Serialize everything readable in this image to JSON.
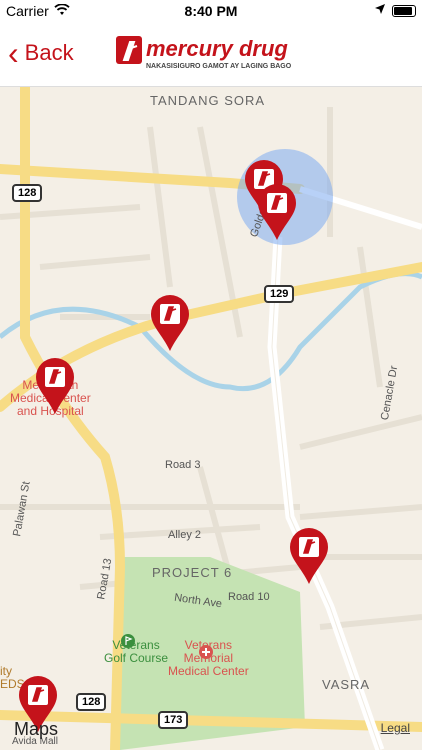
{
  "status": {
    "carrier": "Carrier",
    "time": "8:40 PM"
  },
  "nav": {
    "back_label": "Back",
    "logo_name": "mercury drug",
    "logo_tagline": "NAKASISIGURO GAMOT AY LAGING BAGO",
    "brand_color": "#c4131b"
  },
  "map": {
    "areas": {
      "tandang_sora": "TANDANG SORA",
      "project6": "PROJECT 6",
      "vasra": "VASRA"
    },
    "roads": {
      "road3": "Road 3",
      "alley2": "Alley 2",
      "road10": "Road 10",
      "north_ave": "North Ave",
      "cenacle": "Cenacle Dr",
      "road13": "Road 13",
      "palawan": "Palawan St",
      "golden": "Golde"
    },
    "shields": {
      "s128a": "128",
      "s129": "129",
      "s128b": "128",
      "s173": "173"
    },
    "pois": {
      "north_medical": "Me   North\nMedical Center\nand Hospital",
      "golf": "Veterans\nGolf Course",
      "memorial": "Veterans\nMemorial\nMedical Center",
      "city": "ity\nEDS",
      "avida": "Avida Mall"
    },
    "brand": "Maps",
    "legal": "Legal"
  }
}
